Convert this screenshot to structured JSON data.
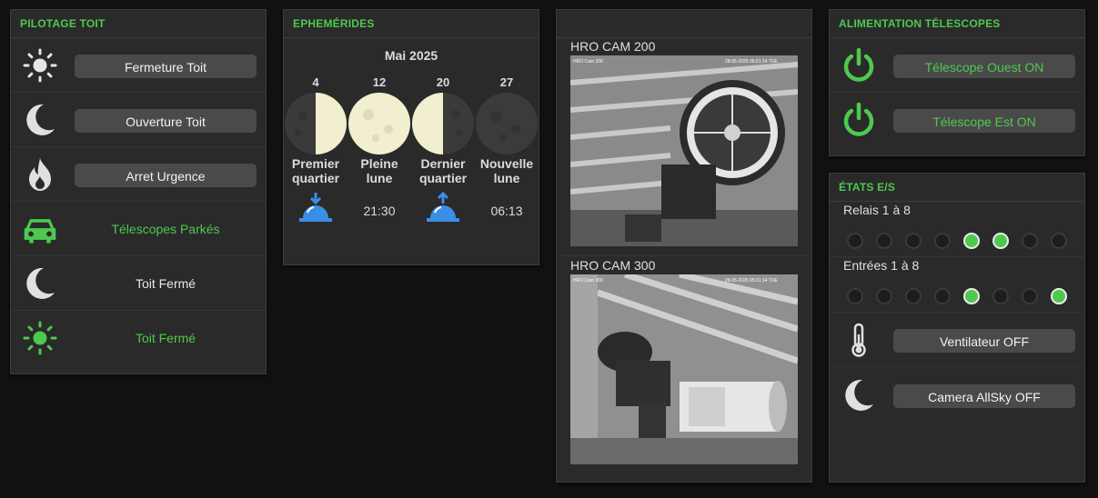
{
  "colors": {
    "accent": "#4ec94e",
    "card_bg": "#2a2a2a",
    "page_bg": "#111111",
    "button_bg": "#4a4a4a"
  },
  "pilotage": {
    "title": "PILOTAGE TOIT",
    "rows": [
      {
        "icon": "sun-icon",
        "label": "Fermeture Toit"
      },
      {
        "icon": "moon-icon",
        "label": "Ouverture Toit"
      },
      {
        "icon": "fire-icon",
        "label": "Arret Urgence"
      },
      {
        "icon": "car-icon",
        "label": "Télescopes Parkés"
      },
      {
        "icon": "moon-icon",
        "label": "Toit Fermé"
      },
      {
        "icon": "sun-icon",
        "label": "Toit Fermé"
      }
    ]
  },
  "ephemerides": {
    "title": "EPHEMÉRIDES",
    "month": "Mai 2025",
    "phases": [
      {
        "day": "4",
        "name_line1": "Premier",
        "name_line2": "quartier",
        "time": "",
        "icon": "bell-down-icon"
      },
      {
        "day": "12",
        "name_line1": "Pleine",
        "name_line2": "lune",
        "time": "21:30",
        "icon": ""
      },
      {
        "day": "20",
        "name_line1": "Dernier",
        "name_line2": "quartier",
        "time": "",
        "icon": "bell-up-icon"
      },
      {
        "day": "27",
        "name_line1": "Nouvelle",
        "name_line2": "lune",
        "time": "06:13",
        "icon": ""
      }
    ]
  },
  "cameras": {
    "title": "",
    "feeds": [
      {
        "label": "HRO CAM 200",
        "overlay_left": "HRO Cam 200",
        "overlay_right": "28-05-2025 05:01:14 TUE"
      },
      {
        "label": "HRO CAM 300",
        "overlay_left": "HRO Cam 300",
        "overlay_right": "28-05-2025 05:01:14 TUE"
      }
    ]
  },
  "alimentation": {
    "title": "ALIMENTATION TÉLESCOPES",
    "rows": [
      {
        "icon": "power-icon",
        "label": "Télescope Ouest ON"
      },
      {
        "icon": "power-icon",
        "label": "Télescope Est ON"
      }
    ]
  },
  "etats": {
    "title": "ÉTATS E/S",
    "relais_label": "Relais 1 à  8",
    "relais_states": [
      false,
      false,
      false,
      false,
      true,
      true,
      false,
      false
    ],
    "entrees_label": "Entrées 1 à  8",
    "entrees_states": [
      false,
      false,
      false,
      false,
      true,
      false,
      false,
      true
    ],
    "rows": [
      {
        "icon": "thermometer-icon",
        "label": "Ventilateur OFF"
      },
      {
        "icon": "moon-icon",
        "label": "Camera AllSky OFF"
      }
    ]
  }
}
